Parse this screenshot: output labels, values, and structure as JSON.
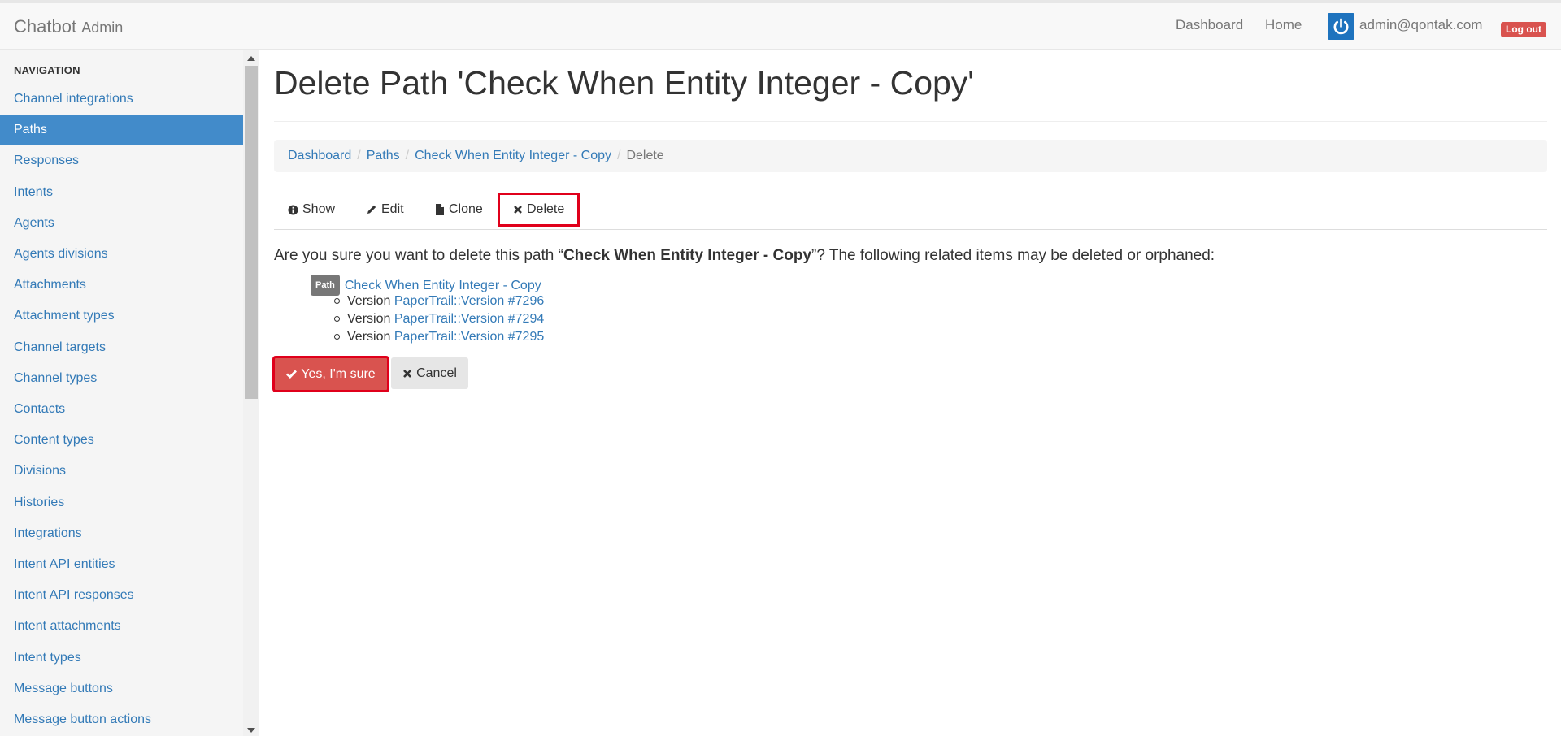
{
  "navbar": {
    "brand": "Chatbot",
    "brand_sub": "Admin",
    "links": [
      "Dashboard",
      "Home"
    ],
    "user_email": "admin@qontak.com",
    "logout_label": "Log out"
  },
  "sidebar": {
    "header": "NAVIGATION",
    "items": [
      {
        "label": "Channel integrations",
        "active": false
      },
      {
        "label": "Paths",
        "active": true
      },
      {
        "label": "Responses",
        "active": false
      },
      {
        "label": "Intents",
        "active": false
      },
      {
        "label": "Agents",
        "active": false
      },
      {
        "label": "Agents divisions",
        "active": false
      },
      {
        "label": "Attachments",
        "active": false
      },
      {
        "label": "Attachment types",
        "active": false
      },
      {
        "label": "Channel targets",
        "active": false
      },
      {
        "label": "Channel types",
        "active": false
      },
      {
        "label": "Contacts",
        "active": false
      },
      {
        "label": "Content types",
        "active": false
      },
      {
        "label": "Divisions",
        "active": false
      },
      {
        "label": "Histories",
        "active": false
      },
      {
        "label": "Integrations",
        "active": false
      },
      {
        "label": "Intent API entities",
        "active": false
      },
      {
        "label": "Intent API responses",
        "active": false
      },
      {
        "label": "Intent attachments",
        "active": false
      },
      {
        "label": "Intent types",
        "active": false
      },
      {
        "label": "Message buttons",
        "active": false
      },
      {
        "label": "Message button actions",
        "active": false
      }
    ]
  },
  "main": {
    "title": "Delete Path 'Check When Entity Integer - Copy'",
    "breadcrumb": {
      "links": [
        "Dashboard",
        "Paths",
        "Check When Entity Integer - Copy"
      ],
      "active": "Delete"
    },
    "tabs": [
      {
        "label": "Show",
        "icon": "info-circle-icon"
      },
      {
        "label": "Edit",
        "icon": "pencil-icon"
      },
      {
        "label": "Clone",
        "icon": "file-icon"
      },
      {
        "label": "Delete",
        "icon": "times-icon"
      }
    ],
    "confirm": {
      "prefix": "Are you sure you want to delete this path “",
      "name": "Check When Entity Integer - Copy",
      "suffix": "”? The following related items may be deleted or orphaned:"
    },
    "related": {
      "badge": "Path",
      "path_link": "Check When Entity Integer - Copy",
      "versions": [
        {
          "label": "Version",
          "link": "PaperTrail::Version #7296"
        },
        {
          "label": "Version",
          "link": "PaperTrail::Version #7294"
        },
        {
          "label": "Version",
          "link": "PaperTrail::Version #7295"
        }
      ]
    },
    "buttons": {
      "confirm_label": "Yes, I'm sure",
      "cancel_label": "Cancel"
    },
    "colors": {
      "accent": "#428bca",
      "link": "#337ab7",
      "danger": "#d9534f",
      "highlight": "#e0001b"
    }
  }
}
